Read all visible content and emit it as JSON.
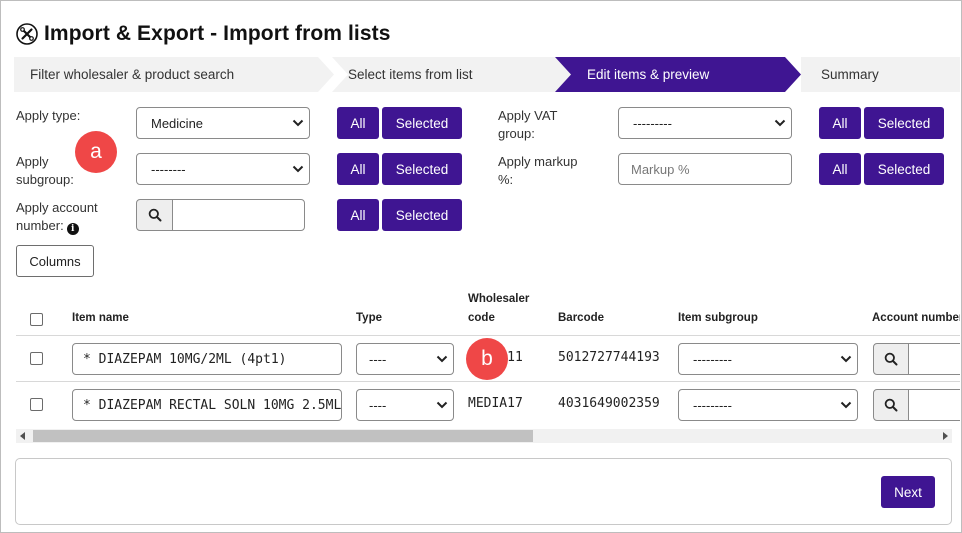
{
  "page": {
    "title": "Import & Export - Import from lists",
    "title_icon": "tools-icon"
  },
  "steps": [
    {
      "label": "Filter wholesaler & product search",
      "active": false
    },
    {
      "label": "Select items from list",
      "active": false
    },
    {
      "label": "Edit items & preview",
      "active": true
    },
    {
      "label": "Summary",
      "active": false
    }
  ],
  "filters": {
    "apply_type": {
      "label": "Apply type:",
      "value": "Medicine"
    },
    "apply_subgroup": {
      "label": "Apply subgroup:",
      "value": "--------"
    },
    "apply_account": {
      "label": "Apply account number:",
      "value": ""
    },
    "apply_vat": {
      "label": "Apply VAT group:",
      "value": "---------"
    },
    "apply_markup": {
      "label": "Apply markup %:",
      "placeholder": "Markup %"
    },
    "all_label": "All",
    "selected_label": "Selected"
  },
  "columns_button": "Columns",
  "markers": {
    "a": "a",
    "b": "b"
  },
  "table": {
    "headers": {
      "item_name": "Item name",
      "type": "Type",
      "wholesaler_code": "Wholesaler code",
      "barcode": "Barcode",
      "item_subgroup": "Item subgroup",
      "account_number": "Account number"
    },
    "rows": [
      {
        "item_name": "* DIAZEPAM 10MG/2ML   (4pt1)",
        "type": "----",
        "wholesaler_code": "MEDIA11",
        "barcode": "5012727744193",
        "item_subgroup": "---------"
      },
      {
        "item_name": "* DIAZEPAM RECTAL SOLN 10MG 2.5ML",
        "type": "----",
        "wholesaler_code": "MEDIA17",
        "barcode": "4031649002359",
        "item_subgroup": "---------"
      }
    ]
  },
  "footer": {
    "next_label": "Next"
  },
  "colors": {
    "accent": "#3f1592",
    "marker": "#ef4747",
    "step_inactive": "#f2f2f2"
  }
}
